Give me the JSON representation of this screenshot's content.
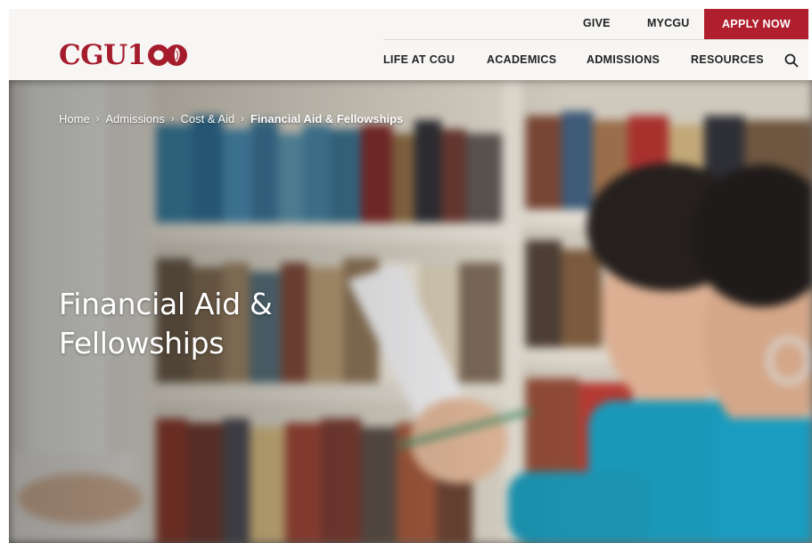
{
  "brand": {
    "logo_text": "CGU1",
    "colors": {
      "primary": "#a51d2d",
      "apply_button": "#b01f2e",
      "header_bg": "#f7f6f4"
    }
  },
  "utility_nav": {
    "give": "GIVE",
    "mycgu": "MYCGU",
    "apply": "APPLY NOW"
  },
  "main_nav": {
    "items": [
      {
        "label": "LIFE AT CGU"
      },
      {
        "label": "ACADEMICS"
      },
      {
        "label": "ADMISSIONS"
      },
      {
        "label": "RESOURCES"
      }
    ],
    "search_icon": "search-icon"
  },
  "breadcrumb": {
    "items": [
      {
        "label": "Home"
      },
      {
        "label": "Admissions"
      },
      {
        "label": "Cost & Aid"
      },
      {
        "label": "Financial Aid & Fellowships"
      }
    ],
    "separator": "›"
  },
  "hero": {
    "title_line1": "Financial Aid &",
    "title_line2": "Fellowships",
    "image": "blurred photo of students reading in a library"
  }
}
